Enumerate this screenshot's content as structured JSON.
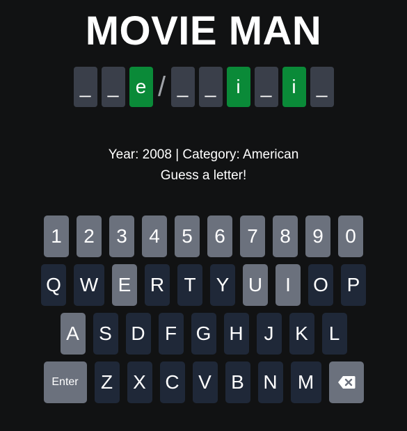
{
  "title": "MOVIE MAN",
  "puzzle": {
    "word1": [
      {
        "char": "_",
        "revealed": false
      },
      {
        "char": "_",
        "revealed": false
      },
      {
        "char": "e",
        "revealed": true
      }
    ],
    "separator": "/",
    "word2": [
      {
        "char": "_",
        "revealed": false
      },
      {
        "char": "_",
        "revealed": false
      },
      {
        "char": "i",
        "revealed": true
      },
      {
        "char": "_",
        "revealed": false
      },
      {
        "char": "i",
        "revealed": true
      },
      {
        "char": "_",
        "revealed": false
      }
    ]
  },
  "info": {
    "meta": "Year: 2008 | Category: American",
    "prompt": "Guess a letter!"
  },
  "keyboard": {
    "row_numbers": [
      "1",
      "2",
      "3",
      "4",
      "5",
      "6",
      "7",
      "8",
      "9",
      "0"
    ],
    "row1": [
      "Q",
      "W",
      "E",
      "R",
      "T",
      "Y",
      "U",
      "I",
      "O",
      "P"
    ],
    "row1_used": [
      "E",
      "U",
      "I"
    ],
    "row2": [
      "A",
      "S",
      "D",
      "F",
      "G",
      "H",
      "J",
      "K",
      "L"
    ],
    "row2_used": [
      "A"
    ],
    "enter_label": "Enter",
    "row3": [
      "Z",
      "X",
      "C",
      "V",
      "B",
      "N",
      "M"
    ],
    "backspace_icon": "backspace-icon"
  },
  "colors": {
    "background": "#111213",
    "tile": "#3a3f4a",
    "tile_revealed": "#0a8a38",
    "key": "#1f2838",
    "key_used": "#6b717d"
  }
}
